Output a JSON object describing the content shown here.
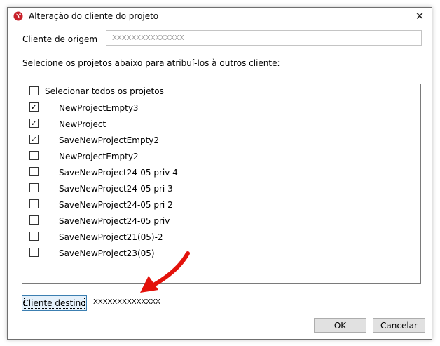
{
  "window": {
    "title": "Alteração do cliente do projeto",
    "close_glyph": "✕",
    "icon": "app-logo-icon"
  },
  "origem": {
    "label": "Cliente de origem",
    "value": "XXXXXXXXXXXXXXX"
  },
  "instruction": "Selecione os projetos abaixo para atribuí-los à outros cliente:",
  "list": {
    "select_all_label": "Selecionar todos os projetos",
    "select_all_checked": false,
    "items": [
      {
        "label": "NewProjectEmpty3",
        "checked": true
      },
      {
        "label": "NewProject",
        "checked": true
      },
      {
        "label": "SaveNewProjectEmpty2",
        "checked": true
      },
      {
        "label": "NewProjectEmpty2",
        "checked": false
      },
      {
        "label": "SaveNewProject24-05 priv 4",
        "checked": false
      },
      {
        "label": "SaveNewProject24-05 pri 3",
        "checked": false
      },
      {
        "label": "SaveNewProject24-05 pri 2",
        "checked": false
      },
      {
        "label": "SaveNewProject24-05 priv",
        "checked": false
      },
      {
        "label": "SaveNewProject21(05)-2",
        "checked": false
      },
      {
        "label": "SaveNewProject23(05)",
        "checked": false
      }
    ]
  },
  "destino": {
    "button_label": "Cliente destino",
    "value": "XXXXXXXXXXXXXX"
  },
  "buttons": {
    "ok": "OK",
    "cancel": "Cancelar"
  },
  "colors": {
    "annotation_arrow": "#e3120b",
    "app_icon": "#c8202a"
  }
}
